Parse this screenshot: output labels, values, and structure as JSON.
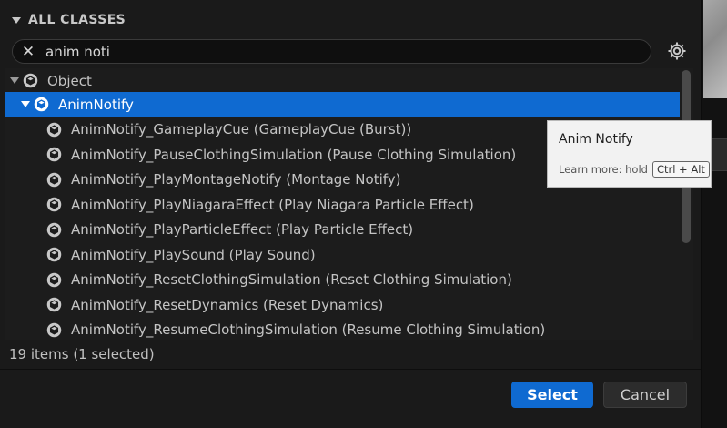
{
  "section": {
    "title": "ALL CLASSES"
  },
  "search": {
    "value": "anim noti",
    "clear_icon": "close-icon"
  },
  "settings": {
    "icon": "gear-icon"
  },
  "tree": {
    "root": {
      "label": "Object",
      "expanded": true
    },
    "selected_node": {
      "label": "AnimNotify",
      "expanded": true
    },
    "children": [
      "AnimNotify_GameplayCue (GameplayCue (Burst))",
      "AnimNotify_PauseClothingSimulation (Pause Clothing Simulation)",
      "AnimNotify_PlayMontageNotify (Montage Notify)",
      "AnimNotify_PlayNiagaraEffect (Play Niagara Particle Effect)",
      "AnimNotify_PlayParticleEffect (Play Particle Effect)",
      "AnimNotify_PlaySound (Play Sound)",
      "AnimNotify_ResetClothingSimulation (Reset Clothing Simulation)",
      "AnimNotify_ResetDynamics (Reset Dynamics)",
      "AnimNotify_ResumeClothingSimulation (Resume Clothing Simulation)"
    ]
  },
  "status": "19 items (1 selected)",
  "buttons": {
    "select": "Select",
    "cancel": "Cancel"
  },
  "tooltip": {
    "title": "Anim Notify",
    "hint": "Learn more: hold",
    "shortcut": "Ctrl + Alt"
  },
  "colors": {
    "accent": "#0f6ad1",
    "background": "#1a1a1a",
    "tooltip_bg": "#f2f2f2"
  }
}
